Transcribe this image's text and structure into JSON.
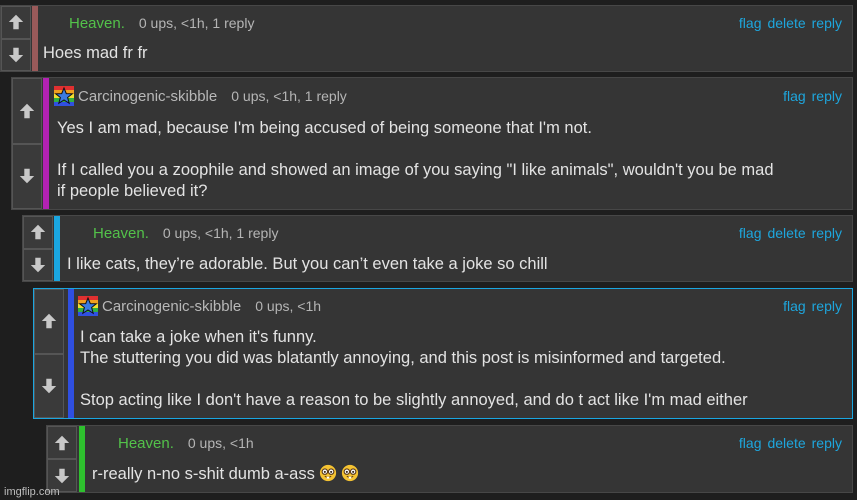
{
  "comments": [
    {
      "user": "Heaven.",
      "meta": "0 ups, <1h, 1 reply",
      "actions": [
        "flag",
        "delete",
        "reply"
      ],
      "lines": [
        "Hoes mad fr fr"
      ],
      "accent": "#9a5a5a"
    },
    {
      "user": "Carcinogenic-skibble",
      "meta": "0 ups, <1h, 1 reply",
      "actions": [
        "flag",
        "reply"
      ],
      "lines": [
        "Yes I am mad, because I'm being accused of being someone that I'm not.",
        "",
        "If I called you a zoophile and showed an image of you saying \"I like animals\", wouldn't you be mad",
        "if people believed it?"
      ],
      "accent": "#b322b3"
    },
    {
      "user": "Heaven.",
      "meta": "0 ups, <1h, 1 reply",
      "actions": [
        "flag",
        "delete",
        "reply"
      ],
      "lines": [
        "I like cats, they’re adorable. But you can’t even take a joke so chill"
      ],
      "accent": "#1aa6e0"
    },
    {
      "user": "Carcinogenic-skibble",
      "meta": "0 ups, <1h",
      "actions": [
        "flag",
        "reply"
      ],
      "lines": [
        "I can take a joke when it's funny.",
        "The stuttering you did was blatantly annoying, and this post is misinformed and targeted.",
        "",
        "Stop acting like I don't have a reason to be slightly annoyed, and do t act like I'm mad either"
      ],
      "accent": "#2f4fe0"
    },
    {
      "user": "Heaven.",
      "meta": "0 ups, <1h",
      "actions": [
        "flag",
        "delete",
        "reply"
      ],
      "lines": [
        "r-really n-no s-shit dumb a-ass"
      ],
      "emoji": [
        "nerd-face-emoji",
        "nerd-face-emoji"
      ],
      "accent": "#2ec02e"
    }
  ],
  "watermark": "imgflip.com",
  "colors": {
    "background": "#1e1e1e",
    "card": "#353535",
    "link": "#1ea6dd",
    "username_green": "#53c24a",
    "highlight_border": "#1aa6e0"
  }
}
